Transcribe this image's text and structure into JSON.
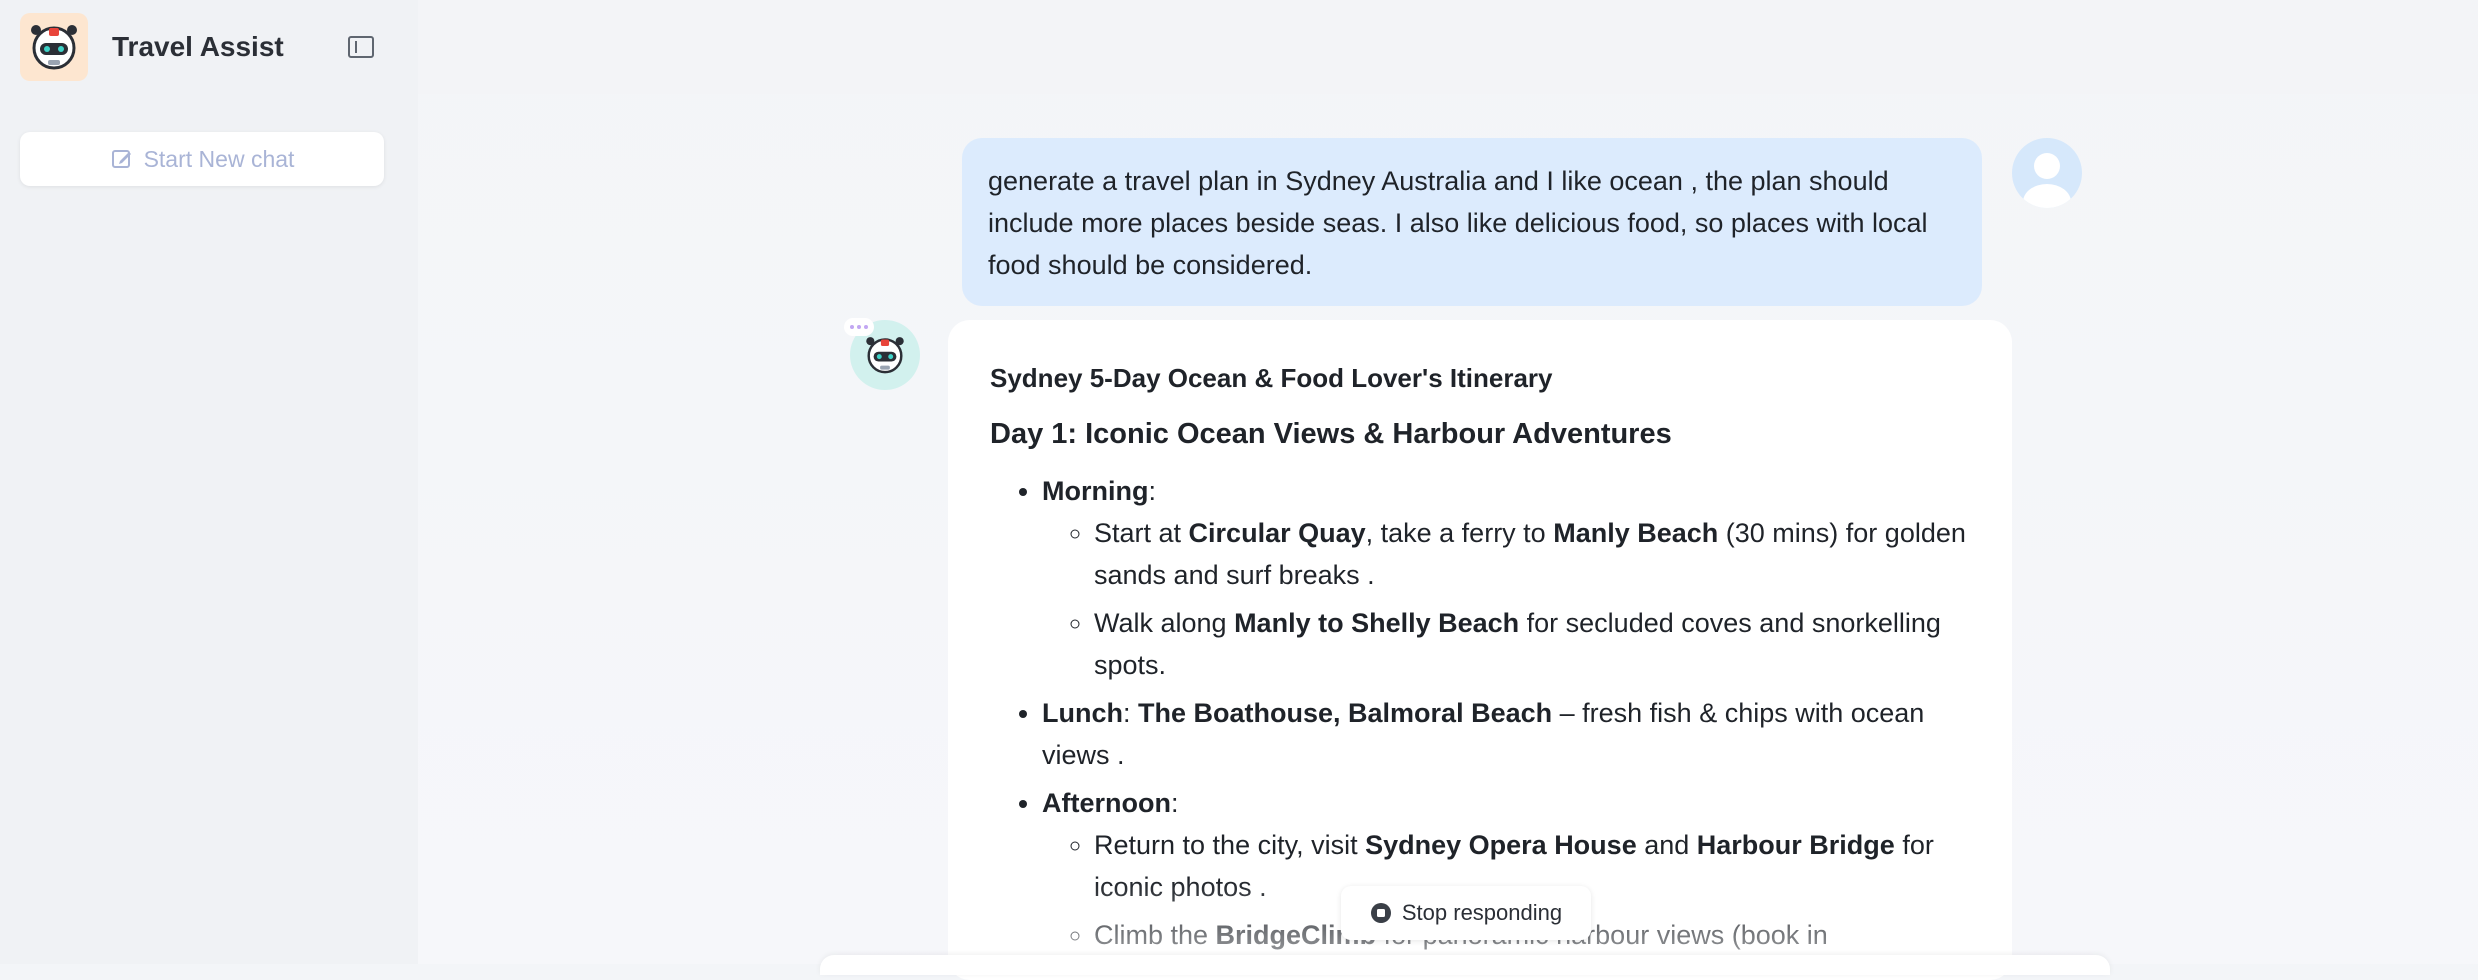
{
  "app": {
    "title": "Travel Assist"
  },
  "sidebar": {
    "new_chat_label": "Start New chat"
  },
  "conversation": {
    "user_message": "generate a travel plan in Sydney Australia and I like ocean , the plan should include more places beside seas. I also like delicious food, so places with local food should be considered.",
    "assistant": {
      "title": "Sydney 5-Day Ocean & Food Lover's Itinerary",
      "day1_heading": "Day 1: Iconic Ocean Views & Harbour Adventures",
      "morning_label": "Morning",
      "m1_a": "Start at ",
      "m1_b": "Circular Quay",
      "m1_c": ", take a ferry to ",
      "m1_d": "Manly Beach",
      "m1_e": " (30 mins) for golden sands and surf breaks .",
      "m2_a": "Walk along ",
      "m2_b": "Manly to Shelly Beach",
      "m2_c": " for secluded coves and snorkelling spots.",
      "lunch_label": "Lunch",
      "lunch_place": "The Boathouse, Balmoral Beach",
      "lunch_desc": " – fresh fish & chips with ocean views .",
      "afternoon_label": "Afternoon",
      "a1_a": "Return to the city, visit ",
      "a1_b": "Sydney Opera House",
      "a1_c": " and ",
      "a1_d": "Harbour Bridge",
      "a1_e": " for iconic photos .",
      "a2_a": "Climb the ",
      "a2_b": "BridgeClimb",
      "a2_c": " for panoramic harbour views (book in"
    }
  },
  "controls": {
    "stop_label": "Stop responding"
  },
  "colors": {
    "user_bubble": "#dcebfd",
    "assistant_bubble": "#ffffff",
    "sidebar_bg": "#f0f2f5",
    "accent": "#a9b4d6"
  }
}
